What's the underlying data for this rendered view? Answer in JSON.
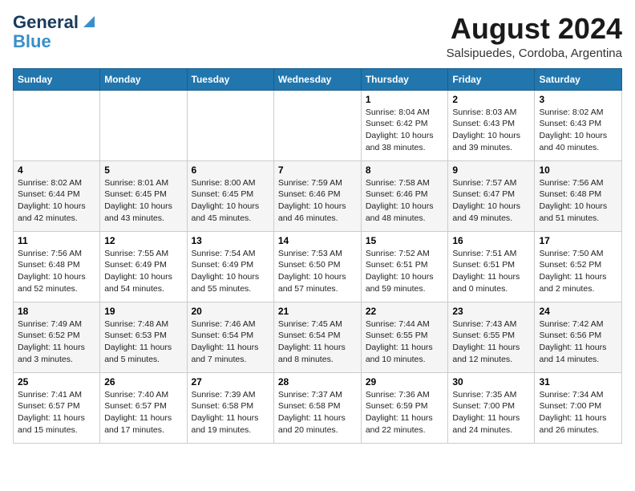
{
  "header": {
    "logo_line1": "General",
    "logo_line2": "Blue",
    "month_title": "August 2024",
    "subtitle": "Salsipuedes, Cordoba, Argentina"
  },
  "days_of_week": [
    "Sunday",
    "Monday",
    "Tuesday",
    "Wednesday",
    "Thursday",
    "Friday",
    "Saturday"
  ],
  "weeks": [
    [
      {
        "day": "",
        "info": ""
      },
      {
        "day": "",
        "info": ""
      },
      {
        "day": "",
        "info": ""
      },
      {
        "day": "",
        "info": ""
      },
      {
        "day": "1",
        "info": "Sunrise: 8:04 AM\nSunset: 6:42 PM\nDaylight: 10 hours\nand 38 minutes."
      },
      {
        "day": "2",
        "info": "Sunrise: 8:03 AM\nSunset: 6:43 PM\nDaylight: 10 hours\nand 39 minutes."
      },
      {
        "day": "3",
        "info": "Sunrise: 8:02 AM\nSunset: 6:43 PM\nDaylight: 10 hours\nand 40 minutes."
      }
    ],
    [
      {
        "day": "4",
        "info": "Sunrise: 8:02 AM\nSunset: 6:44 PM\nDaylight: 10 hours\nand 42 minutes."
      },
      {
        "day": "5",
        "info": "Sunrise: 8:01 AM\nSunset: 6:45 PM\nDaylight: 10 hours\nand 43 minutes."
      },
      {
        "day": "6",
        "info": "Sunrise: 8:00 AM\nSunset: 6:45 PM\nDaylight: 10 hours\nand 45 minutes."
      },
      {
        "day": "7",
        "info": "Sunrise: 7:59 AM\nSunset: 6:46 PM\nDaylight: 10 hours\nand 46 minutes."
      },
      {
        "day": "8",
        "info": "Sunrise: 7:58 AM\nSunset: 6:46 PM\nDaylight: 10 hours\nand 48 minutes."
      },
      {
        "day": "9",
        "info": "Sunrise: 7:57 AM\nSunset: 6:47 PM\nDaylight: 10 hours\nand 49 minutes."
      },
      {
        "day": "10",
        "info": "Sunrise: 7:56 AM\nSunset: 6:48 PM\nDaylight: 10 hours\nand 51 minutes."
      }
    ],
    [
      {
        "day": "11",
        "info": "Sunrise: 7:56 AM\nSunset: 6:48 PM\nDaylight: 10 hours\nand 52 minutes."
      },
      {
        "day": "12",
        "info": "Sunrise: 7:55 AM\nSunset: 6:49 PM\nDaylight: 10 hours\nand 54 minutes."
      },
      {
        "day": "13",
        "info": "Sunrise: 7:54 AM\nSunset: 6:49 PM\nDaylight: 10 hours\nand 55 minutes."
      },
      {
        "day": "14",
        "info": "Sunrise: 7:53 AM\nSunset: 6:50 PM\nDaylight: 10 hours\nand 57 minutes."
      },
      {
        "day": "15",
        "info": "Sunrise: 7:52 AM\nSunset: 6:51 PM\nDaylight: 10 hours\nand 59 minutes."
      },
      {
        "day": "16",
        "info": "Sunrise: 7:51 AM\nSunset: 6:51 PM\nDaylight: 11 hours\nand 0 minutes."
      },
      {
        "day": "17",
        "info": "Sunrise: 7:50 AM\nSunset: 6:52 PM\nDaylight: 11 hours\nand 2 minutes."
      }
    ],
    [
      {
        "day": "18",
        "info": "Sunrise: 7:49 AM\nSunset: 6:52 PM\nDaylight: 11 hours\nand 3 minutes."
      },
      {
        "day": "19",
        "info": "Sunrise: 7:48 AM\nSunset: 6:53 PM\nDaylight: 11 hours\nand 5 minutes."
      },
      {
        "day": "20",
        "info": "Sunrise: 7:46 AM\nSunset: 6:54 PM\nDaylight: 11 hours\nand 7 minutes."
      },
      {
        "day": "21",
        "info": "Sunrise: 7:45 AM\nSunset: 6:54 PM\nDaylight: 11 hours\nand 8 minutes."
      },
      {
        "day": "22",
        "info": "Sunrise: 7:44 AM\nSunset: 6:55 PM\nDaylight: 11 hours\nand 10 minutes."
      },
      {
        "day": "23",
        "info": "Sunrise: 7:43 AM\nSunset: 6:55 PM\nDaylight: 11 hours\nand 12 minutes."
      },
      {
        "day": "24",
        "info": "Sunrise: 7:42 AM\nSunset: 6:56 PM\nDaylight: 11 hours\nand 14 minutes."
      }
    ],
    [
      {
        "day": "25",
        "info": "Sunrise: 7:41 AM\nSunset: 6:57 PM\nDaylight: 11 hours\nand 15 minutes."
      },
      {
        "day": "26",
        "info": "Sunrise: 7:40 AM\nSunset: 6:57 PM\nDaylight: 11 hours\nand 17 minutes."
      },
      {
        "day": "27",
        "info": "Sunrise: 7:39 AM\nSunset: 6:58 PM\nDaylight: 11 hours\nand 19 minutes."
      },
      {
        "day": "28",
        "info": "Sunrise: 7:37 AM\nSunset: 6:58 PM\nDaylight: 11 hours\nand 20 minutes."
      },
      {
        "day": "29",
        "info": "Sunrise: 7:36 AM\nSunset: 6:59 PM\nDaylight: 11 hours\nand 22 minutes."
      },
      {
        "day": "30",
        "info": "Sunrise: 7:35 AM\nSunset: 7:00 PM\nDaylight: 11 hours\nand 24 minutes."
      },
      {
        "day": "31",
        "info": "Sunrise: 7:34 AM\nSunset: 7:00 PM\nDaylight: 11 hours\nand 26 minutes."
      }
    ]
  ]
}
